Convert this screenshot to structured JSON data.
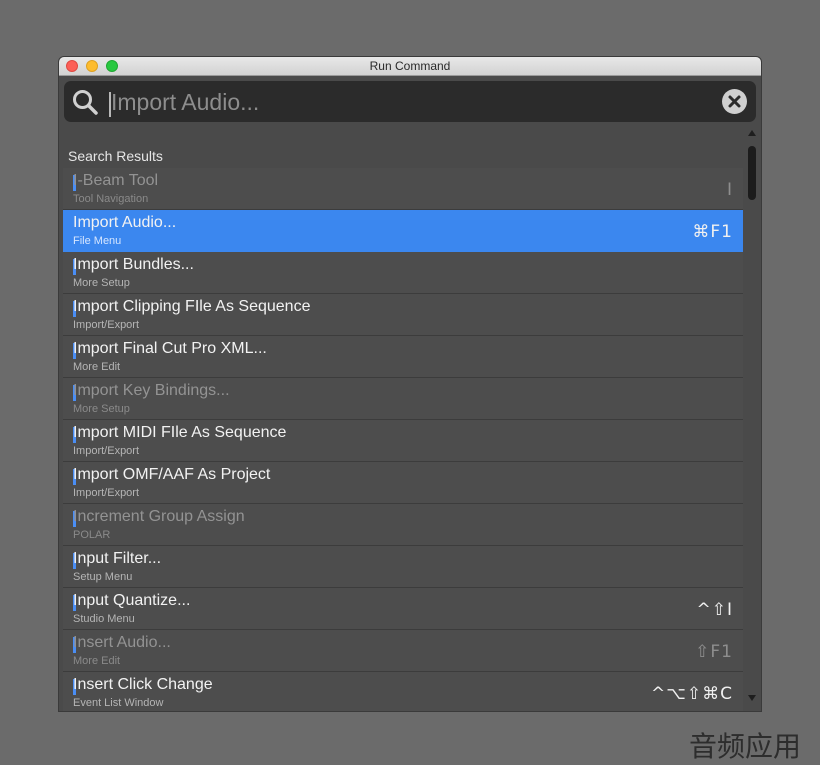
{
  "window": {
    "title": "Run Command"
  },
  "search": {
    "value": "Import Audio...",
    "placeholder": ""
  },
  "results_label": "Search Results",
  "results": [
    {
      "label": "I-Beam Tool",
      "category": "Tool Navigation",
      "shortcut": "I",
      "state": "disabled"
    },
    {
      "label": "Import Audio...",
      "category": "File Menu",
      "shortcut": "⌘F1",
      "state": "selected"
    },
    {
      "label": "Import Bundles...",
      "category": "More Setup",
      "shortcut": "",
      "state": "normal"
    },
    {
      "label": "Import Clipping FIle As Sequence",
      "category": "Import/Export",
      "shortcut": "",
      "state": "normal"
    },
    {
      "label": "Import Final Cut Pro XML...",
      "category": "More Edit",
      "shortcut": "",
      "state": "normal"
    },
    {
      "label": "Import Key Bindings...",
      "category": "More Setup",
      "shortcut": "",
      "state": "disabled"
    },
    {
      "label": "Import MIDI FIle As Sequence",
      "category": "Import/Export",
      "shortcut": "",
      "state": "normal"
    },
    {
      "label": "Import OMF/AAF As Project",
      "category": "Import/Export",
      "shortcut": "",
      "state": "normal"
    },
    {
      "label": "Increment Group Assign",
      "category": "POLAR",
      "shortcut": "",
      "state": "disabled"
    },
    {
      "label": "Input Filter...",
      "category": "Setup Menu",
      "shortcut": "",
      "state": "normal"
    },
    {
      "label": "Input Quantize...",
      "category": "Studio Menu",
      "shortcut": "^⇧I",
      "state": "normal"
    },
    {
      "label": "Insert Audio...",
      "category": "More Edit",
      "shortcut": "⇧F1",
      "state": "disabled"
    },
    {
      "label": "Insert Click Change",
      "category": "Event List Window",
      "shortcut": "^⌥⇧⌘C",
      "state": "normal"
    }
  ],
  "watermark": "音频应用",
  "colors": {
    "selection": "#3b87ef",
    "match_marker": "#4a8ef5",
    "background": "#4d4d4d"
  }
}
